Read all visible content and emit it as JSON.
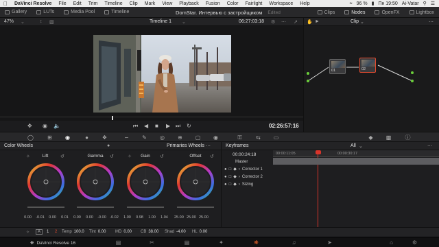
{
  "menubar": {
    "app_name": "DaVinci Resolve",
    "items": [
      "File",
      "Edit",
      "Trim",
      "Timeline",
      "Clip",
      "Mark",
      "View",
      "Playback",
      "Fusion",
      "Color",
      "Fairlight",
      "Workspace",
      "Help"
    ],
    "battery": "96 %",
    "datetime": "Пн 19:50",
    "user": "Ai-Vatar"
  },
  "toolbar": {
    "gallery": "Gallery",
    "luts": "LUTs",
    "media_pool": "Media Pool",
    "timeline": "Timeline",
    "project_title": "DomStar. Интервью с застройщиком",
    "edited": "Edited",
    "clips": "Clips",
    "nodes": "Nodes",
    "openfx": "OpenFX",
    "lightbox": "Lightbox"
  },
  "viewer": {
    "zoom": "47%",
    "timeline_name": "Timeline 1",
    "source_timecode": "06:27:03:18",
    "record_timecode": "02:26:57:16"
  },
  "node_editor": {
    "mode": "Clip",
    "nodes": [
      {
        "label": "01"
      },
      {
        "label": "02"
      }
    ]
  },
  "color_wheels": {
    "title": "Color Wheels",
    "mode": "Primaries Wheels",
    "wheels": [
      {
        "name": "Lift",
        "master": [
          "0.00",
          "-0.01",
          "0.00",
          "0.01"
        ],
        "rgb": [
          "0.00",
          "0.00",
          "0.00",
          "0.00"
        ]
      },
      {
        "name": "Gamma",
        "master": [
          "0.00",
          "0.00",
          "-0.00",
          "-0.02"
        ],
        "rgb": [
          "0.00",
          "0.00",
          "0.00",
          "0.00"
        ]
      },
      {
        "name": "Gain",
        "master": [
          "1.00",
          "0.98",
          "1.00",
          "1.04"
        ],
        "rgb": [
          "1.00",
          "1.00",
          "1.00",
          "1.00"
        ]
      },
      {
        "name": "Offset",
        "master": [
          "25.00",
          "25.00",
          "25.00"
        ],
        "rgb": [
          "25.00",
          "25.00",
          "25.00"
        ]
      }
    ]
  },
  "keyframes": {
    "title": "Keyframes",
    "filter": "All",
    "timecode": "00:00:24:18",
    "ruler": [
      "00:00:11:05",
      "00:00:30:17"
    ],
    "rows": [
      "Master",
      "Corrector 1",
      "Corrector 2",
      "Sizing"
    ]
  },
  "adjust": {
    "page1": "1",
    "page2": "2",
    "temp_label": "Temp",
    "temp": "100.0",
    "tint_label": "Tint",
    "tint": "0.00",
    "md_label": "MD",
    "md": "0.00",
    "cb_label": "CB",
    "cb": "38.00",
    "shad_label": "Shad",
    "shad": "-4.00",
    "hl_label": "HL",
    "hl": "0.00"
  },
  "pagebar": {
    "brand": "DaVinci Resolve 16"
  },
  "colors": {
    "accent": "#e04a2f",
    "playhead": "#d9342b",
    "selected_page": "#e8622a"
  }
}
